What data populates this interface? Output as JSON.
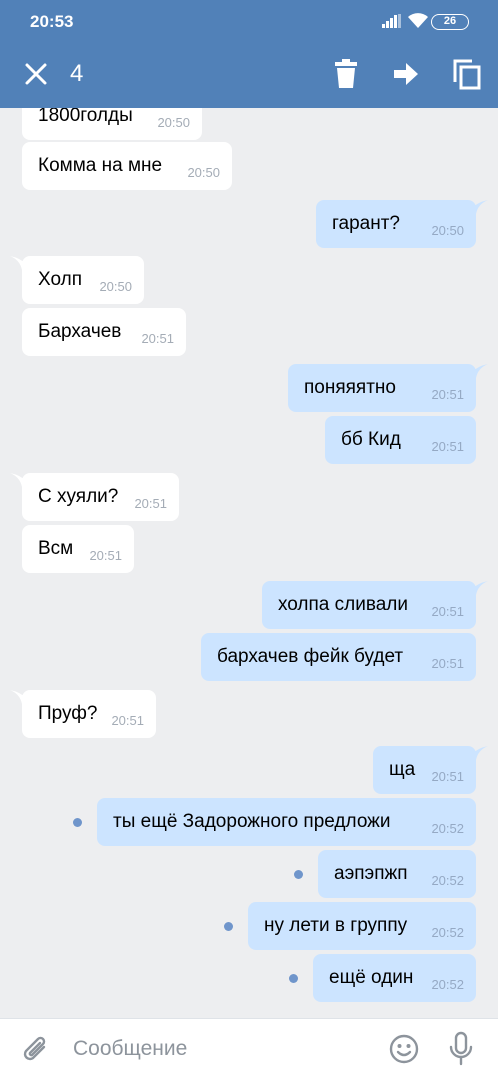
{
  "status_bar": {
    "time": "20:53",
    "battery": "26"
  },
  "header": {
    "selected_count": "4"
  },
  "colors": {
    "header": "#5181b8",
    "incoming": "#ffffff",
    "outgoing": "#cce4ff",
    "unread_dot": "#6f95cb",
    "background": "#edeef0"
  },
  "icons": [
    "close-icon",
    "trash-icon",
    "forward-icon",
    "copy-icon",
    "paperclip-icon",
    "emoji-icon",
    "microphone-icon"
  ],
  "messages": [
    {
      "dir": "in",
      "text": "1800голды",
      "time": "20:50"
    },
    {
      "dir": "in",
      "text": "Комма на мне",
      "time": "20:50"
    },
    {
      "dir": "out",
      "text": "гарант?",
      "time": "20:50"
    },
    {
      "dir": "in",
      "text": "Холп",
      "time": "20:50"
    },
    {
      "dir": "in",
      "text": "Бархачев",
      "time": "20:51"
    },
    {
      "dir": "out",
      "text": "поняяятно",
      "time": "20:51"
    },
    {
      "dir": "out",
      "text": "бб Кид",
      "time": "20:51"
    },
    {
      "dir": "in",
      "text": "С хуяли?",
      "time": "20:51"
    },
    {
      "dir": "in",
      "text": "Всм",
      "time": "20:51"
    },
    {
      "dir": "out",
      "text": "холпа сливали",
      "time": "20:51"
    },
    {
      "dir": "out",
      "text": "бархачев фейк будет",
      "time": "20:51"
    },
    {
      "dir": "in",
      "text": "Пруф?",
      "time": "20:51"
    },
    {
      "dir": "out",
      "text": "ща",
      "time": "20:51"
    },
    {
      "dir": "out",
      "text": "ты ещё Задорожного предложи",
      "time": "20:52",
      "unread": true
    },
    {
      "dir": "out",
      "text": "аэпэпжп",
      "time": "20:52",
      "unread": true
    },
    {
      "dir": "out",
      "text": "ну лети в группу",
      "time": "20:52",
      "unread": true
    },
    {
      "dir": "out",
      "text": "ещё один",
      "time": "20:52",
      "unread": true
    }
  ],
  "composer": {
    "placeholder": "Сообщение"
  }
}
